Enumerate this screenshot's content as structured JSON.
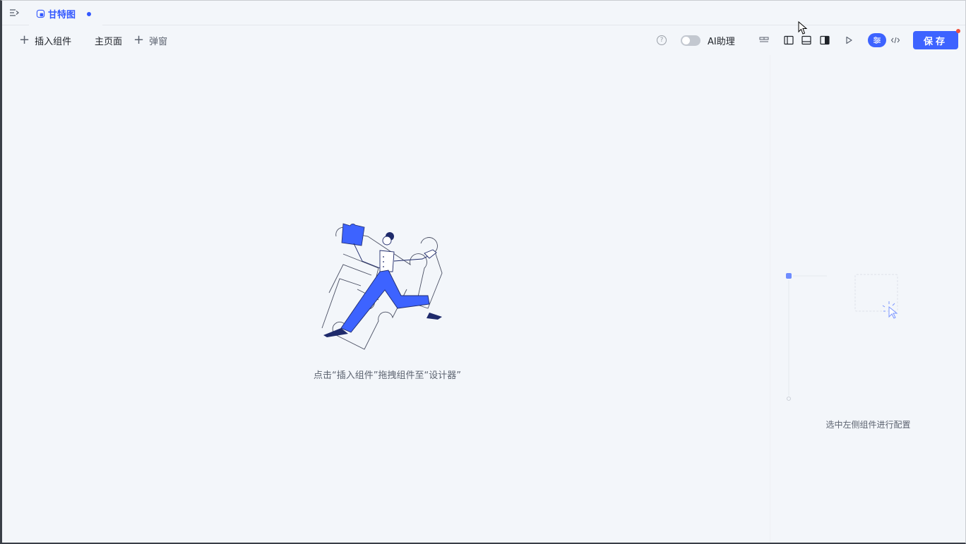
{
  "tabbar": {
    "tab_label": "甘特图"
  },
  "toolbar": {
    "insert_component": "插入组件",
    "main_page": "主页面",
    "popup": "弹窗",
    "ai_assistant": "AI助理",
    "save": "保存"
  },
  "canvas": {
    "empty_hint": "点击“插入组件”拖拽组件至“设计器”"
  },
  "right_panel": {
    "hint": "选中左侧组件进行配置"
  },
  "colors": {
    "accent": "#3d63ff",
    "tab_active": "#3358ff",
    "notify_dot": "#f0503c",
    "background": "#f3f6fa"
  },
  "icons": {
    "menu_toggle": "menu-collapse-icon",
    "tab": "chart-icon",
    "help": "question-circle-icon",
    "layout_1": "layout-top-icon",
    "layout_2": "panel-left-icon",
    "layout_3": "panel-bottom-icon",
    "layout_4": "panel-right-filled-icon",
    "preview": "play-icon",
    "settings": "sliders-icon",
    "code": "code-icon"
  }
}
